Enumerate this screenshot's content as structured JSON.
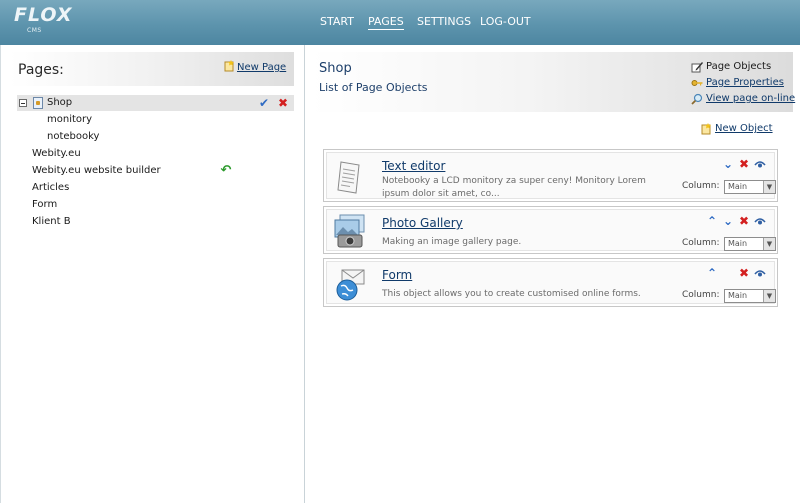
{
  "header": {
    "logo_text": "FLOX",
    "logo_sub": "CMS",
    "nav": [
      {
        "label": "START",
        "active": false
      },
      {
        "label": "PAGES",
        "active": true
      },
      {
        "label": "SETTINGS",
        "active": false
      },
      {
        "label": "LOG-OUT",
        "active": false
      }
    ]
  },
  "left": {
    "title": "Pages:",
    "new_page_label": "New Page",
    "tree": [
      {
        "label": "Shop",
        "level": 0,
        "selected": true
      },
      {
        "label": "monitory",
        "level": 1
      },
      {
        "label": "notebooky",
        "level": 1
      },
      {
        "label": "Webity.eu",
        "level": 0
      },
      {
        "label": "Webity.eu website builder",
        "level": 0
      },
      {
        "label": "Articles",
        "level": 0
      },
      {
        "label": "Form",
        "level": 0
      },
      {
        "label": "Klient B",
        "level": 0
      }
    ]
  },
  "right": {
    "page_title": "Shop",
    "page_subtitle": "List of Page Objects",
    "side_links": [
      {
        "label": "Page Objects",
        "link": false,
        "icon": "pencil-icon"
      },
      {
        "label": "Page Properties",
        "link": true,
        "icon": "key-icon"
      },
      {
        "label": "View page on-line",
        "link": true,
        "icon": "magnifier-icon"
      }
    ],
    "new_object_label": "New Object",
    "objects": [
      {
        "title": "Text editor",
        "description": "Notebooky a LCD monitory za super ceny! Monitory Lorem ipsum dolor sit amet, co...",
        "column_label": "Column:",
        "column_value": "Main",
        "icon": "document-icon"
      },
      {
        "title": "Photo Gallery",
        "description": "Making an image gallery page.",
        "column_label": "Column:",
        "column_value": "Main",
        "icon": "camera-icon"
      },
      {
        "title": "Form",
        "description": "This object allows you to create customised online forms.",
        "column_label": "Column:",
        "column_value": "Main",
        "icon": "globe-mail-icon"
      }
    ]
  },
  "colors": {
    "header": "#5d94ad",
    "link": "#103a6a",
    "delete": "#d32020",
    "arrow": "#2f6bc3",
    "undo": "#2c9a2c"
  }
}
